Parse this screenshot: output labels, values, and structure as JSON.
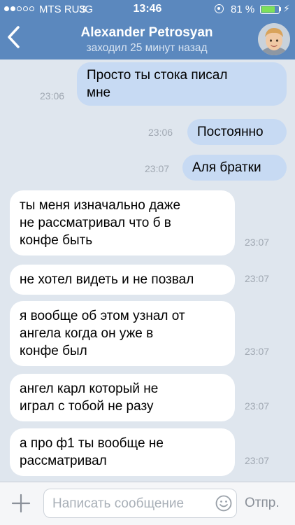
{
  "status_bar": {
    "carrier": "MTS RUS",
    "network": "3G",
    "time": "13:46",
    "battery_percent": "81 %",
    "battery_level": 0.81,
    "battery_color": "#7ee05a"
  },
  "header": {
    "back_icon": "chevron-left-icon",
    "contact_name": "Alexander Petrosyan",
    "last_seen": "заходил 25 минут назад",
    "bar_color": "#5b88be"
  },
  "messages": [
    {
      "direction": "out",
      "text": "Просто ты стока писал\nмне",
      "time": "23:06"
    },
    {
      "direction": "out",
      "text": "Постоянно",
      "time": "23:06"
    },
    {
      "direction": "out",
      "text": "Аля братки",
      "time": "23:07"
    },
    {
      "direction": "in",
      "text": "ты меня изначально даже\nне рассматривал что б в\nконфе быть",
      "time": "23:07"
    },
    {
      "direction": "in",
      "text": "не хотел видеть и не позвал",
      "time": "23:07"
    },
    {
      "direction": "in",
      "text": "я вообще об этом узнал от\nангела когда он уже в\nконфе был",
      "time": "23:07"
    },
    {
      "direction": "in",
      "text": "ангел карл который не\nиграл с тобой не разу",
      "time": "23:07"
    },
    {
      "direction": "in",
      "text": "а про ф1 ты вообще не\nрассматривал",
      "time": "23:07"
    }
  ],
  "composer": {
    "attach_icon": "plus-icon",
    "placeholder": "Написать сообщение",
    "emoji_icon": "smiley-icon",
    "send_label": "Отпр."
  },
  "colors": {
    "outgoing_bubble": "#c7daf3",
    "incoming_bubble": "#ffffff",
    "chat_background": "#dfe6ee"
  }
}
